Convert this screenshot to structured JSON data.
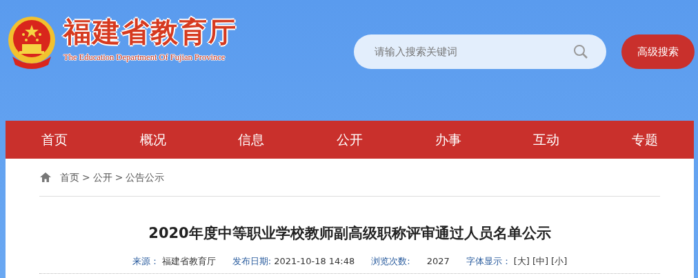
{
  "header": {
    "title": "福建省教育厅",
    "subtitle": "The Education Department Of Fujian Province",
    "search": {
      "placeholder": "请输入搜索关键词"
    },
    "advanced_button": "高级搜索"
  },
  "nav": [
    {
      "label": "首页"
    },
    {
      "label": "概况"
    },
    {
      "label": "信息"
    },
    {
      "label": "公开"
    },
    {
      "label": "办事"
    },
    {
      "label": "互动"
    },
    {
      "label": "专题"
    }
  ],
  "breadcrumb": {
    "separator": ">",
    "items": [
      "首页",
      "公开",
      "公告公示"
    ]
  },
  "article": {
    "title": "2020年度中等职业学校教师副高级职称评审通过人员名单公示",
    "meta": [
      {
        "label": "来源：",
        "value": "福建省教育厅"
      },
      {
        "label": "发布日期:",
        "value": "2021-10-18 14:48"
      },
      {
        "label": "浏览次数:",
        "value": "2027"
      }
    ],
    "font_size": {
      "label": "字体显示：",
      "options": [
        "[大]",
        "[中]",
        "[小]"
      ]
    }
  }
}
